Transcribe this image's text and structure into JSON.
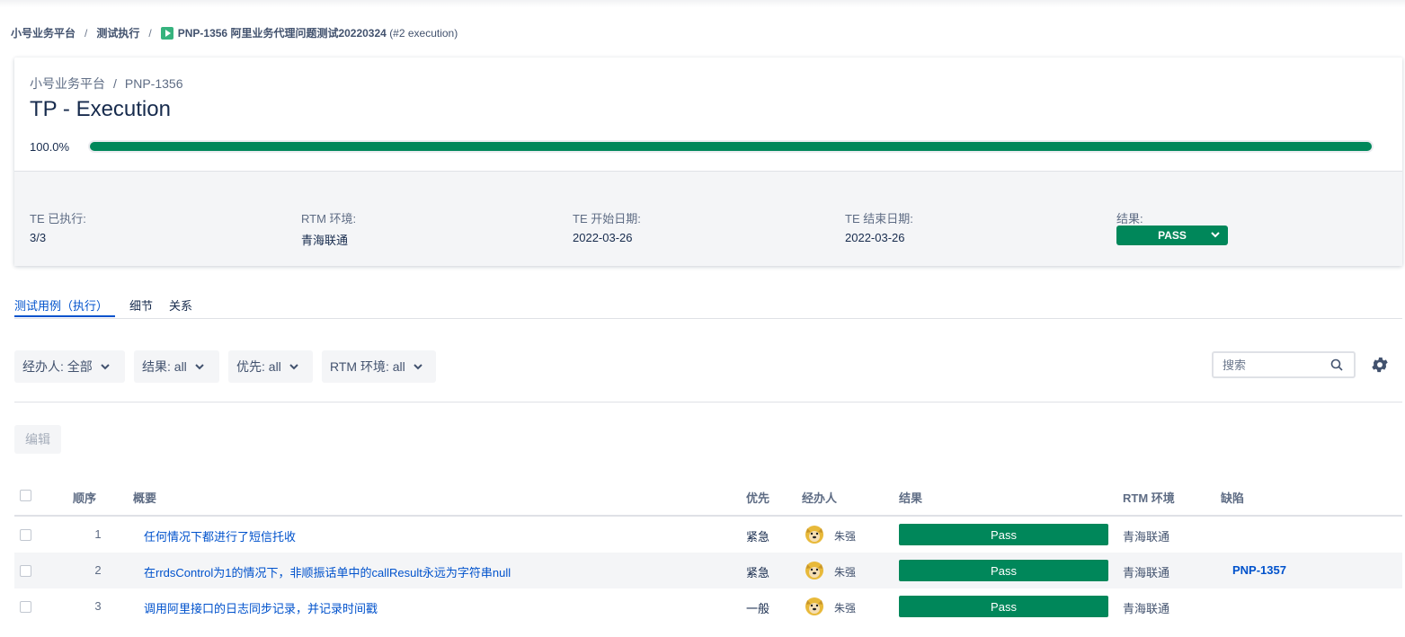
{
  "breadcrumb": {
    "project": "小号业务平台",
    "section": "测试执行",
    "current_key": "PNP-1356",
    "current_title": "阿里业务代理问题测试20220324",
    "current_exec": "(#2 execution)",
    "sep": "/"
  },
  "card": {
    "project": "小号业务平台",
    "key": "PNP-1356",
    "sep": "/",
    "title": "TP - Execution",
    "progress_label": "100.0%",
    "progress_fraction": 1.0,
    "fields": {
      "te_executed_label": "TE 已执行:",
      "te_executed_value": "3/3",
      "rtm_env_label": "RTM 环境:",
      "rtm_env_value": "青海联通",
      "te_start_label": "TE 开始日期:",
      "te_start_value": "2022-03-26",
      "te_end_label": "TE 结束日期:",
      "te_end_value": "2022-03-26",
      "result_label": "结果:",
      "result_value": "PASS"
    }
  },
  "tabs": [
    "测试用例（执行）",
    "细节",
    "关系"
  ],
  "filters": {
    "assignee": "经办人: 全部",
    "result": "结果: all",
    "priority": "优先: all",
    "rtm_env": "RTM 环境: all"
  },
  "search": {
    "placeholder": "搜索"
  },
  "edit_button": "编辑",
  "table": {
    "headers": {
      "order": "顺序",
      "summary": "概要",
      "priority": "优先",
      "assignee": "经办人",
      "result": "结果",
      "rtm_env": "RTM 环境",
      "defects": "缺陷"
    },
    "rows": [
      {
        "order": "1",
        "summary": "任何情况下都进行了短信托收",
        "priority": "紧急",
        "assignee": "朱强",
        "result": "Pass",
        "rtm_env": "青海联通",
        "defect": ""
      },
      {
        "order": "2",
        "summary": "在rrdsControl为1的情况下，非顺振话单中的callResult永远为字符串null",
        "priority": "紧急",
        "assignee": "朱强",
        "result": "Pass",
        "rtm_env": "青海联通",
        "defect": "PNP-1357"
      },
      {
        "order": "3",
        "summary": "调用阿里接口的日志同步记录，并记录时间戳",
        "priority": "一般",
        "assignee": "朱强",
        "result": "Pass",
        "rtm_env": "青海联通",
        "defect": ""
      }
    ]
  },
  "colors": {
    "accent": "#0052cc",
    "pass": "#00875a",
    "bg_panel": "#f4f5f7"
  },
  "icons": [
    "play-icon",
    "chevron-down-icon",
    "search-icon",
    "gear-icon",
    "avatar-icon"
  ]
}
